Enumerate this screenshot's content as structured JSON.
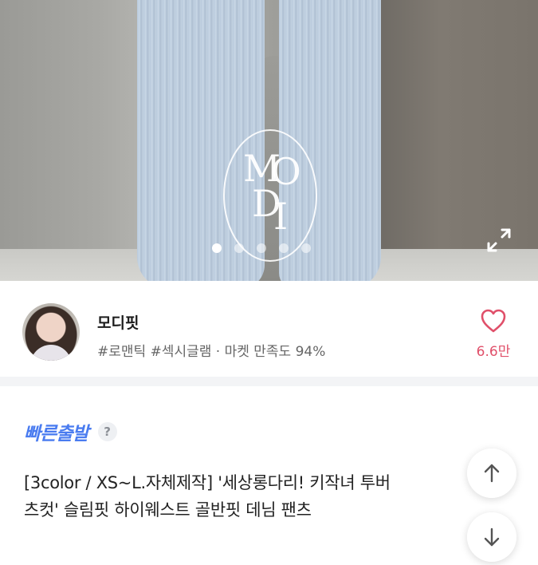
{
  "hero": {
    "logo_letters": [
      "M",
      "O",
      "D",
      "I"
    ],
    "carousel": {
      "total": 5,
      "active_index": 0
    },
    "expand_icon": "expand-arrows-icon"
  },
  "seller": {
    "name": "모디핏",
    "tags": "#로맨틱 #섹시글램 · 마켓 만족도 94%",
    "like_icon": "heart-outline-icon",
    "like_count": "6.6만",
    "accent_color": "#e0506a"
  },
  "product": {
    "badge": "빠른출발",
    "badge_color": "#4a7cf0",
    "help_label": "?",
    "title_line1": "[3color / XS~L.자체제작] '세상롱다리! 키작녀 투버",
    "title_line2": "츠컷' 슬림핏 하이웨스트 골반핏 데님 팬츠"
  },
  "floating_buttons": {
    "scroll_up_icon": "arrow-up-icon",
    "scroll_down_icon": "arrow-down-icon"
  }
}
